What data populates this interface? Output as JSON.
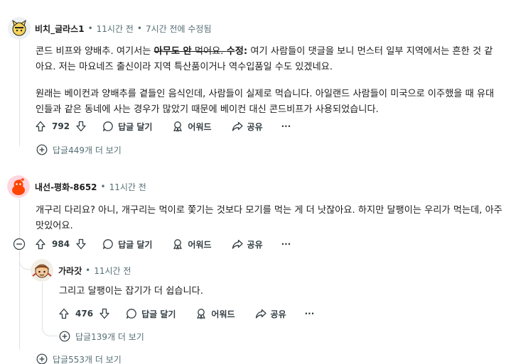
{
  "comments": [
    {
      "username": "비치_글라스1",
      "time": "11시간 전",
      "edited_prefix": "7시간 전",
      "edited_suffix": "에 수정됨",
      "line1_a": "콘드 비프와 양배추. 여기서는 ",
      "line1_strike": "아무도 안",
      "line1_strike2": " 먹어요",
      "line1_b": ". ",
      "line1_edit_label": "수정:",
      "line1_c": " 여기 사람들이 댓글을 보니 먼스터 일부 지역에서는 흔한 것 같",
      "line2": "아요. 저는 마요네즈 출신이라 지역 특산품이거나 역수입품일 수도 있겠네요.",
      "para2_line1": "원래는 베이컨과 양배추를 곁들인 음식인데, 사람들이 실제로 먹습니다. 아일랜드 사람들이 미국으로 이주했을 때 유대",
      "para2_line2": "인들과 같은 동네에 사는 경우가 많았기 때문에 베이컨 대신 콘드비프가 사용되었습니다.",
      "votes": "792",
      "reply_label": "답글 달기",
      "award_label": "어워드",
      "share_label": "공유",
      "more_label": "···",
      "more_replies": "답글449개 더 보기"
    },
    {
      "username": "내선-평화-8652",
      "time": "11시간 전",
      "line1": "개구리 다리요? 아니, 개구리는 먹이로 쫓기는 것보다 모기를 먹는 게 더 낫잖아요. 하지만 달팽이는 우리가 먹는데, 아주",
      "line2": "맛있어요.",
      "votes": "984",
      "reply_label": "답글 달기",
      "award_label": "어워드",
      "share_label": "공유",
      "more_label": "···",
      "more_replies": "답글553개 더 보기",
      "reply": {
        "username": "가라갓",
        "time": "11시간 전",
        "text": "그리고 달팽이는 잡기가 더 쉽습니다.",
        "votes": "476",
        "reply_label": "답글 달기",
        "award_label": "어워드",
        "share_label": "공유",
        "more_label": "···",
        "more_replies": "답글139개 더 보기"
      }
    }
  ],
  "icons": {
    "upvote": "arrow-up-icon",
    "downvote": "arrow-down-icon",
    "reply": "speech-bubble-icon",
    "award": "award-ribbon-icon",
    "share": "share-arrow-icon",
    "expand": "plus-circle-icon",
    "collapse": "minus-circle-icon"
  },
  "colors": {
    "meta_text": "#576f76",
    "thread_line": "#dfe1e3",
    "avatar2_bg": "#ff4500"
  }
}
